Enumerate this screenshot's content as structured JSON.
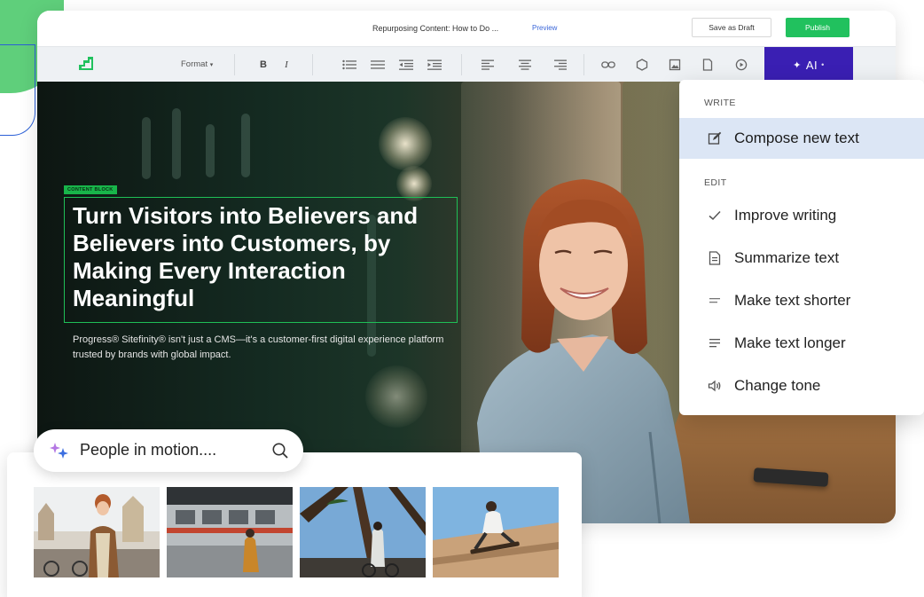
{
  "editor": {
    "doc_title": "Repurposing Content: How to Do ...",
    "preview_label": "Preview",
    "save_draft_label": "Save as Draft",
    "publish_label": "Publish"
  },
  "toolbar": {
    "format_label": "Format",
    "bold_label": "B",
    "italic_label": "I",
    "ai_label": "AI"
  },
  "hero": {
    "badge": "CONTENT BLOCK",
    "title": "Turn Visitors into Believers and Believers into Customers, by Making Every Interaction Meaningful",
    "subtitle": "Progress® Sitefinity® isn't just a CMS—it's a customer-first digital experience platform trusted by brands with global impact."
  },
  "ai_menu": {
    "section_write": "WRITE",
    "section_edit": "EDIT",
    "items": [
      {
        "label": "Compose new text",
        "icon": "edit-icon"
      },
      {
        "label": "Improve writing",
        "icon": "check-icon"
      },
      {
        "label": "Summarize text",
        "icon": "document-icon"
      },
      {
        "label": "Make text shorter",
        "icon": "short-lines-icon"
      },
      {
        "label": "Make text longer",
        "icon": "long-lines-icon"
      },
      {
        "label": "Change tone",
        "icon": "speaker-icon"
      }
    ]
  },
  "image_search": {
    "query": "People in motion...."
  },
  "colors": {
    "brand_green": "#5fcf7b",
    "publish_green": "#21c15e",
    "ai_purple": "#3a1fb3",
    "content_block_green": "#1fbf56",
    "menu_active": "#dce6f5"
  }
}
